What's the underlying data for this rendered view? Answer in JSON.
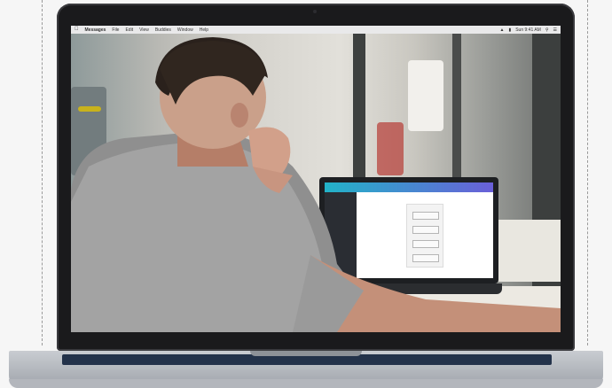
{
  "menubar": {
    "app_name": "Messages",
    "menu_items": [
      "File",
      "Edit",
      "View",
      "Buddies",
      "Window",
      "Help"
    ],
    "clock": "Sun 9:41 AM"
  },
  "colors": {
    "laptop_frame": "#1a1a1c",
    "screen_bar_accent_start": "#22b3c8",
    "screen_bar_accent_end": "#6a5fd8",
    "keyboard": "#23324a",
    "page_bg": "#f6f6f6"
  }
}
